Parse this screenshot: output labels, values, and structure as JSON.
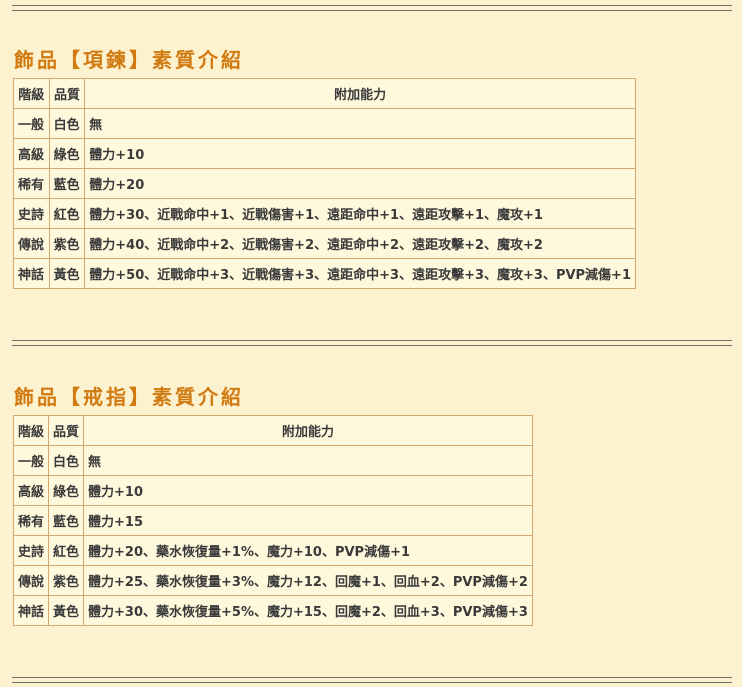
{
  "sections": [
    {
      "title": "飾品【項鍊】素質介紹",
      "headers": [
        "階級",
        "品質",
        "附加能力"
      ],
      "rows": [
        {
          "tier": "一般",
          "quality": "白色",
          "quality_color": "#7d7d7d",
          "effect": "無"
        },
        {
          "tier": "高級",
          "quality": "綠色",
          "quality_color": "#13a313",
          "effect": "體力+10"
        },
        {
          "tier": "稀有",
          "quality": "藍色",
          "quality_color": "#1f4fb8",
          "effect": "體力+20"
        },
        {
          "tier": "史詩",
          "quality": "紅色",
          "quality_color": "#d01e1e",
          "effect": "體力+30、近戰命中+1、近戰傷害+1、遠距命中+1、遠距攻擊+1、魔攻+1"
        },
        {
          "tier": "傳說",
          "quality": "紫色",
          "quality_color": "#8a2be2",
          "effect": "體力+40、近戰命中+2、近戰傷害+2、遠距命中+2、遠距攻擊+2、魔攻+2"
        },
        {
          "tier": "神話",
          "quality": "黃色",
          "quality_color": "#d98a10",
          "effect": "體力+50、近戰命中+3、近戰傷害+3、遠距命中+3、遠距攻擊+3、魔攻+3、PVP減傷+1"
        }
      ]
    },
    {
      "title": "飾品【戒指】素質介紹",
      "headers": [
        "階級",
        "品質",
        "附加能力"
      ],
      "rows": [
        {
          "tier": "一般",
          "quality": "白色",
          "quality_color": "#7d7d7d",
          "effect": "無"
        },
        {
          "tier": "高級",
          "quality": "綠色",
          "quality_color": "#13a313",
          "effect": "體力+10"
        },
        {
          "tier": "稀有",
          "quality": "藍色",
          "quality_color": "#1f4fb8",
          "effect": "體力+15"
        },
        {
          "tier": "史詩",
          "quality": "紅色",
          "quality_color": "#d01e1e",
          "effect": "體力+20、藥水恢復量+1%、魔力+10、PVP減傷+1"
        },
        {
          "tier": "傳說",
          "quality": "紫色",
          "quality_color": "#8a2be2",
          "effect": "體力+25、藥水恢復量+3%、魔力+12、回魔+1、回血+2、PVP減傷+2"
        },
        {
          "tier": "神話",
          "quality": "黃色",
          "quality_color": "#d98a10",
          "effect": "體力+30、藥水恢復量+5%、魔力+15、回魔+2、回血+3、PVP減傷+3"
        }
      ]
    }
  ]
}
